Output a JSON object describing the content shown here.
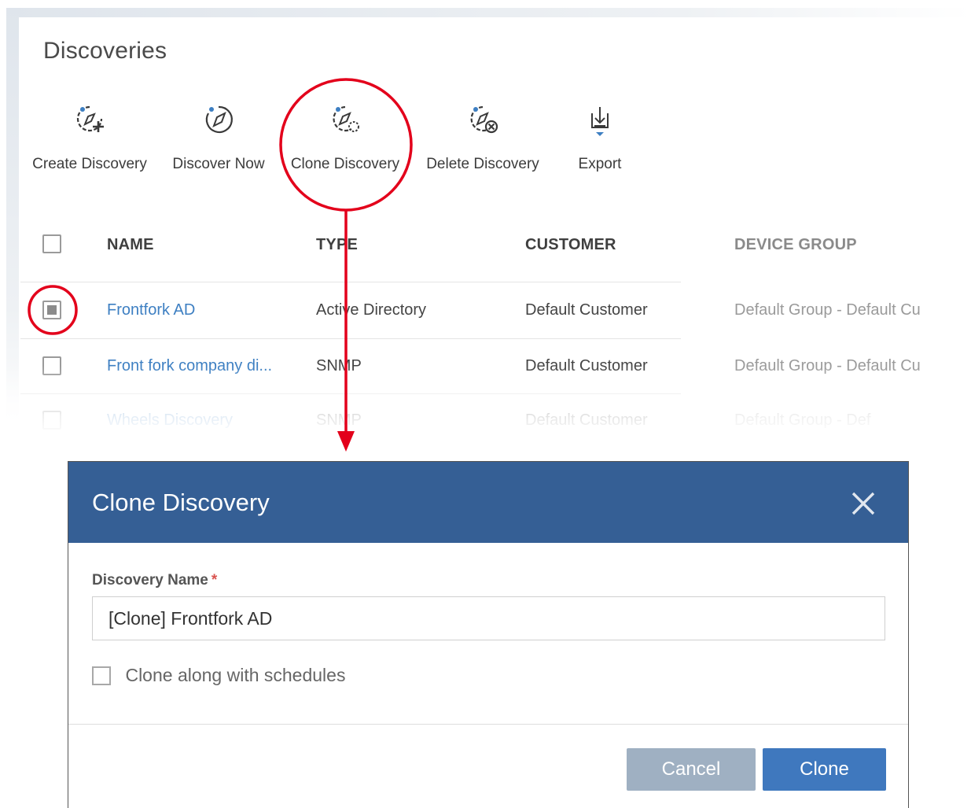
{
  "page": {
    "title": "Discoveries"
  },
  "toolbar": {
    "create_label": "Create Discovery",
    "discover_now_label": "Discover Now",
    "clone_label": "Clone Discovery",
    "delete_label": "Delete Discovery",
    "export_label": "Export"
  },
  "table": {
    "headers": {
      "name": "NAME",
      "type": "TYPE",
      "customer": "CUSTOMER",
      "device_group": "DEVICE GROUP"
    },
    "rows": [
      {
        "checked": true,
        "name": "Frontfork AD",
        "type": "Active Directory",
        "customer": "Default Customer",
        "device_group": "Default Group - Default Cu"
      },
      {
        "checked": false,
        "name": "Front fork company di...",
        "type": "SNMP",
        "customer": "Default Customer",
        "device_group": "Default Group - Default Cu"
      },
      {
        "checked": false,
        "name": "Wheels Discovery",
        "type": "SNMP",
        "customer": "Default Customer",
        "device_group": "Default Group - Def"
      }
    ]
  },
  "modal": {
    "title": "Clone Discovery",
    "field_label": "Discovery Name",
    "required_mark": "*",
    "name_value": "[Clone] Frontfork AD",
    "schedule_checkbox_label": "Clone along with schedules",
    "cancel_label": "Cancel",
    "clone_label": "Clone"
  },
  "colors": {
    "header_blue": "#355f95",
    "primary_button": "#3f78be",
    "secondary_button": "#9fb0c2",
    "link": "#3d7fc2",
    "annotation_red": "#e3001b"
  },
  "icons": [
    "create-discovery-icon",
    "discover-now-icon",
    "clone-discovery-icon",
    "delete-discovery-icon",
    "export-icon",
    "close-icon"
  ]
}
